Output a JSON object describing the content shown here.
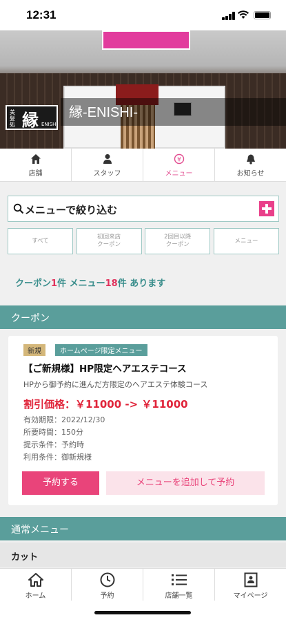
{
  "status": {
    "time": "12:31"
  },
  "hero": {
    "logo_small": "美髪処",
    "logo_kanji": "縁",
    "logo_sub": "ENISHI",
    "shop_name": "縁-ENISHI-"
  },
  "top_tabs": [
    {
      "label": "店舗",
      "icon": "home-icon"
    },
    {
      "label": "スタッフ",
      "icon": "person-icon"
    },
    {
      "label": "メニュー",
      "icon": "yen-icon",
      "active": true
    },
    {
      "label": "お知らせ",
      "icon": "bell-icon"
    }
  ],
  "search": {
    "placeholder": "メニューで絞り込む"
  },
  "filters": [
    {
      "label": "すべて"
    },
    {
      "label": "初回来店\nクーポン"
    },
    {
      "label": "2回目以降\nクーポン"
    },
    {
      "label": "メニュー"
    }
  ],
  "count": {
    "coupon_label": "クーポン",
    "coupon_count": "1",
    "unit1": "件",
    "menu_label": "メニュー",
    "menu_count": "18",
    "unit2": "件",
    "suffix": "あります"
  },
  "coupon_section": {
    "title": "クーポン"
  },
  "coupon": {
    "badge_new": "新規",
    "badge_hp": "ホームページ限定メニュー",
    "title": "【ご新規様】HP限定ヘアエステコース",
    "description": "HPから御予約に進んだ方限定のヘアエステ体験コース",
    "price": "割引価格：￥11000 -> ￥11000",
    "expiry": "有効期限：2022/12/30",
    "duration": "所要時間：150分",
    "present_condition": "提示条件：予約時",
    "use_condition": "利用条件：御新規様",
    "book_button": "予約する",
    "add_button": "メニューを追加して予約"
  },
  "regular_section": {
    "title": "通常メニュー"
  },
  "category": {
    "title": "カット"
  },
  "bottom_nav": [
    {
      "label": "ホーム",
      "icon": "home-icon"
    },
    {
      "label": "予約",
      "icon": "clock-icon"
    },
    {
      "label": "店舗一覧",
      "icon": "list-icon"
    },
    {
      "label": "マイページ",
      "icon": "id-card-icon"
    }
  ],
  "colors": {
    "accent": "#e9447a",
    "teal": "#5a9e9b",
    "price_red": "#e0243a"
  }
}
